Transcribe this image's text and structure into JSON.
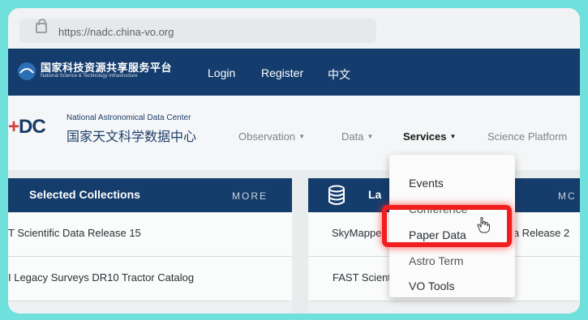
{
  "browser": {
    "url": "https://nadc.china-vo.org"
  },
  "topbar": {
    "brand_cn": "国家科技资源共享服务平台",
    "brand_en": "National Science & Technology Infrastructure",
    "links": [
      "Login",
      "Register",
      "中文"
    ]
  },
  "header": {
    "org_en": "National Astronomical Data Center",
    "org_cn": "国家天文科学数据中心",
    "logo_text": "DC",
    "menu": [
      {
        "label": "Observation",
        "active": false,
        "has_caret": true
      },
      {
        "label": "Data",
        "active": false,
        "has_caret": true
      },
      {
        "label": "Services",
        "active": true,
        "has_caret": true
      },
      {
        "label": "Science Platform",
        "active": false,
        "has_caret": false
      }
    ]
  },
  "selected_collections": {
    "title": "Selected Collections",
    "more": "MORE",
    "items": [
      "T Scientific Data Release 15",
      "I Legacy Surveys DR10 Tractor Catalog"
    ]
  },
  "latest_panel": {
    "title_fragment": "La",
    "more": "MC",
    "items": [
      {
        "left": "SkyMappe",
        "right": "ata Release 2"
      },
      {
        "left": "FAST Scient",
        "right": ""
      }
    ]
  },
  "services_dropdown": {
    "items": [
      "Events",
      "Conference",
      "Paper Data",
      "Astro Term",
      "VO Tools"
    ],
    "highlighted": "Paper Data"
  },
  "colors": {
    "nav_bg": "#143d6d",
    "accent_red": "#f01e1e",
    "page_bg": "#6fe0dc"
  },
  "icons": {
    "lock": "lock-icon",
    "database": "database-icon",
    "pointer": "hand-cursor-icon"
  }
}
